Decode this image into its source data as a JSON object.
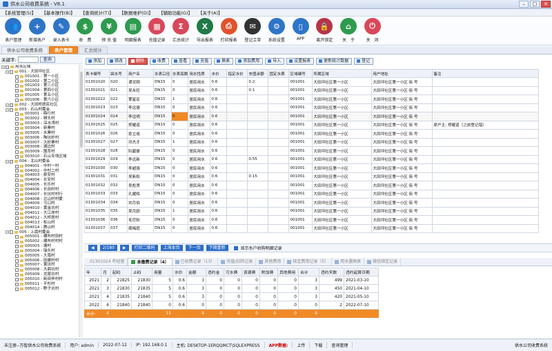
{
  "window": {
    "title": "供水公司收费系统 - V8.1"
  },
  "menu": [
    "【系统管理(S)】",
    "【基本操作(B)】",
    "【查询统计(T)】",
    "【数据维护(D)】",
    "【辅助功能(G)】",
    "【关于(A)】"
  ],
  "toolbar": [
    {
      "label": "表户管理",
      "icon": "users-icon",
      "color": "#2e75c9"
    },
    {
      "label": "新增表户",
      "icon": "add-user-icon",
      "color": "#2e75c9"
    },
    {
      "label": "录入表卡",
      "icon": "card-entry-icon",
      "color": "#2e75c9"
    },
    {
      "label": "收　费",
      "icon": "dollar-icon",
      "color": "#2e9b4e"
    },
    {
      "label": "预 充 值",
      "icon": "money-bag-icon",
      "color": "#2e9b4e"
    },
    {
      "label": "明细报表",
      "icon": "report-icon",
      "color": "#2e9b4e"
    },
    {
      "label": "充值记录",
      "icon": "record-icon",
      "color": "#d9475a"
    },
    {
      "label": "汇总统计",
      "icon": "summary-icon",
      "color": "#d9475a"
    },
    {
      "label": "导出报表",
      "icon": "excel-icon",
      "color": "#1f7a45"
    },
    {
      "label": "打印报表",
      "icon": "printer-icon",
      "color": "#e0522c"
    },
    {
      "label": "登记工单",
      "icon": "ticket-icon",
      "color": "#333333"
    },
    {
      "label": "系统设置",
      "icon": "gear-icon",
      "color": "#2e75c9"
    },
    {
      "label": "APP",
      "icon": "phone-icon",
      "color": "#2e75c9"
    },
    {
      "label": "离开锁定",
      "icon": "lock-icon",
      "color": "#b7344a"
    },
    {
      "label": "关　于",
      "icon": "home-icon",
      "color": "#2e9b4e"
    },
    {
      "label": "关　闭",
      "icon": "power-icon",
      "color": "#d9475a"
    }
  ],
  "tabs": [
    "供水公司收费系统",
    "表户管理",
    "汇总统计"
  ],
  "search": {
    "label": "关键字:",
    "button": "查询"
  },
  "tree": [
    {
      "level": 0,
      "text": "用水区域"
    },
    {
      "level": 1,
      "text": "001 - 大田坪社区"
    },
    {
      "level": 2,
      "text": "001001 - 第一小区"
    },
    {
      "level": 2,
      "text": "001002 - 第二小区"
    },
    {
      "level": 2,
      "text": "001003 - 第三小区"
    },
    {
      "level": 2,
      "text": "001004 - 第四小区"
    },
    {
      "level": 2,
      "text": "001005 - 第五小区"
    },
    {
      "level": 2,
      "text": "001006 - 第六小区"
    },
    {
      "level": 1,
      "text": "002 - 大田桥居民社区"
    },
    {
      "level": 1,
      "text": "003 - 石山村委会"
    },
    {
      "level": 2,
      "text": "003001 - 鼎行村"
    },
    {
      "level": 2,
      "text": "003002 - 狮头村"
    },
    {
      "level": 2,
      "text": "003003 - 深水湾村"
    },
    {
      "level": 2,
      "text": "003004 - 新寨村"
    },
    {
      "level": 2,
      "text": "003005 - 水寨村"
    },
    {
      "level": 2,
      "text": "003006 - 陶坑岭村"
    },
    {
      "level": 2,
      "text": "003007 - 大岭寨村"
    },
    {
      "level": 2,
      "text": "003008 - 湖边村"
    },
    {
      "level": 2,
      "text": "003009 - 围背村"
    },
    {
      "level": 2,
      "text": "003010 - 石山专场区域"
    },
    {
      "level": 1,
      "text": "004 - 北山村委会"
    },
    {
      "level": 2,
      "text": "004001 - 中村一村"
    },
    {
      "level": 2,
      "text": "004002 - 中村二村"
    },
    {
      "level": 2,
      "text": "004003 - 箭安村"
    },
    {
      "level": 2,
      "text": "004004 - 长安村"
    },
    {
      "level": 2,
      "text": "004005 - 长乐村"
    },
    {
      "level": 2,
      "text": "004006 - 长田村村"
    },
    {
      "level": 2,
      "text": "004007 - 长坑村村行"
    },
    {
      "level": 2,
      "text": "004008 - 北山村村委"
    },
    {
      "level": 2,
      "text": "004009 - 马口村"
    },
    {
      "level": 2,
      "text": "004010 - 黄金坑村"
    },
    {
      "level": 2,
      "text": "004011 - 大江岸村"
    },
    {
      "level": 2,
      "text": "004012 - 大桥居村"
    },
    {
      "level": 2,
      "text": "004013 - 松山村"
    },
    {
      "level": 2,
      "text": "004014 - 鹿山村"
    },
    {
      "level": 1,
      "text": "005 - 上南村委会"
    },
    {
      "level": 2,
      "text": "005001 - 横布村田村"
    },
    {
      "level": 2,
      "text": "005002 - 横布村村村"
    },
    {
      "level": 2,
      "text": "005003 - 塘村"
    },
    {
      "level": 2,
      "text": "005004 - 瑞头村"
    },
    {
      "level": 2,
      "text": "005005 - 大南村"
    },
    {
      "level": 2,
      "text": "005006 - 田建村村"
    },
    {
      "level": 2,
      "text": "005007 - 黄坑村"
    },
    {
      "level": 2,
      "text": "005008 - 大鼎坑村"
    },
    {
      "level": 2,
      "text": "005009 - 龙尾坑村"
    },
    {
      "level": 2,
      "text": "005010 - 新田甲村村"
    },
    {
      "level": 2,
      "text": "005011 - 平杉村"
    },
    {
      "level": 2,
      "text": "005012 - 野子坑村"
    }
  ],
  "actions": [
    "添加",
    "修改",
    "删除",
    "收费",
    "查看",
    "充值",
    "换表",
    "添加费用",
    "导入",
    "设置报表",
    "更新统计数据",
    "登记"
  ],
  "meters": {
    "columns": [
      "表卡编号",
      "袋水号",
      "用户名",
      "水表口径",
      "水表底数",
      "用水性质",
      "水价",
      "指定水价",
      "充值余额",
      "固定水费",
      "区域编号",
      "所属区域",
      "用户地址",
      "备注"
    ],
    "rows": [
      [
        "01301020",
        "020",
        "谭灵刚",
        "DN15",
        "0",
        "居民用水",
        "0.6",
        "",
        "0.2",
        "",
        "001001",
        "大田坪社区第一小区",
        "大田坪社区第一小区 街 号",
        ""
      ],
      [
        "01301021",
        "021",
        "吴永旺",
        "DN15",
        "0",
        "居民用水",
        "0.6",
        "",
        "0.1",
        "",
        "001001",
        "大田坪社区第一小区",
        "大田坪社区第一小区 街 号",
        ""
      ],
      [
        "01301022",
        "022",
        "覃星宏",
        "DN15",
        "1",
        "居民用水",
        "0.6",
        "",
        "",
        "",
        "001001",
        "大田坪社区第一小区",
        "大田坪社区第一小区 街 号",
        ""
      ],
      [
        "01301023",
        "023",
        "李远德",
        "DN15",
        "0",
        "居民用水",
        "0.6",
        "",
        "",
        "",
        "001001",
        "大田坪社区第一小区",
        "大田坪社区第一小区 街 号",
        ""
      ],
      [
        "01301024",
        "024",
        "李远明",
        "DN15",
        "0",
        "居民用水",
        "0.6",
        "",
        "",
        "",
        "001001",
        "大田坪社区第一小区",
        "大田坪社区第一小区 街 号",
        ""
      ],
      [
        "01301025",
        "025",
        "郑耀道",
        "DN15",
        "0",
        "居民用水",
        "0.6",
        "",
        "",
        "",
        "001001",
        "大田坪社区第一小区",
        "大田坪社区第一小区 街 号",
        "原户主: 郑耀道（之前登记错）"
      ],
      [
        "01301026",
        "026",
        "俞立成",
        "DN15",
        "0",
        "居民用水",
        "0.6",
        "",
        "",
        "",
        "001001",
        "大田坪社区第一小区",
        "大田坪社区第一小区 街 号",
        ""
      ],
      [
        "01301027",
        "027",
        "邓杰才",
        "DN15",
        "1",
        "居民用水",
        "0.6",
        "",
        "",
        "",
        "001001",
        "大田坪社区第一小区",
        "大田坪社区第一小区 街 号",
        ""
      ],
      [
        "01301028",
        "028",
        "阮碧晏",
        "DN15",
        "0",
        "居民用水",
        "0.6",
        "",
        "",
        "",
        "001001",
        "大田坪社区第一小区",
        "大田坪社区第一小区 街 号",
        ""
      ],
      [
        "01301029",
        "029",
        "李远新",
        "DN15",
        "0",
        "居民用水",
        "0.6",
        "",
        "0.55",
        "",
        "001001",
        "大田坪社区第一小区",
        "大田坪社区第一小区 街 号",
        ""
      ],
      [
        "01301030",
        "030",
        "李超强",
        "DN15",
        "0",
        "居民用水",
        "0.6",
        "",
        "",
        "",
        "001001",
        "大田坪社区第一小区",
        "大田坪社区第一小区 街 号",
        ""
      ],
      [
        "01301031",
        "031",
        "吴新和",
        "DN15",
        "0",
        "居民用水",
        "0.6",
        "",
        "0.15",
        "",
        "001001",
        "大田坪社区第一小区",
        "大田坪社区第一小区 街 号",
        ""
      ],
      [
        "01301032",
        "032",
        "吴彪贤",
        "DN15",
        "0",
        "居民用水",
        "0.6",
        "",
        "",
        "",
        "001001",
        "大田坪社区第一小区",
        "大田坪社区第一小区 街 号",
        ""
      ],
      [
        "01301033",
        "033",
        "孔耀辉",
        "DN15",
        "0",
        "居民用水",
        "0.6",
        "",
        "",
        "",
        "001001",
        "大田坪社区第一小区",
        "大田坪社区第一小区 街 号",
        ""
      ],
      [
        "01301034",
        "034",
        "刘月伯",
        "DN15",
        "0",
        "居民用水",
        "0.6",
        "",
        "",
        "",
        "001001",
        "大田坪社区第一小区",
        "大田坪社区第一小区 街 号",
        ""
      ],
      [
        "01301035",
        "035",
        "吴月欧",
        "DN15",
        "1",
        "居民用水",
        "0.6",
        "",
        "",
        "",
        "001001",
        "大田坪社区第一小区",
        "大田坪社区第一小区 街 号",
        ""
      ],
      [
        "01301036",
        "036",
        "毛尽秋",
        "DN15",
        "0",
        "居民用水",
        "0.6",
        "",
        "",
        "",
        "001001",
        "大田坪社区第一小区",
        "大田坪社区第一小区 街 号",
        ""
      ],
      [
        "01301037",
        "037",
        "周梅庭",
        "DN15",
        "0",
        "居民用水",
        "0.6",
        "",
        "",
        "",
        "001001",
        "大田坪社区第一小区",
        "大田坪社区第一小区 街 号",
        ""
      ]
    ]
  },
  "pager": {
    "first": "◀",
    "page": "2/180",
    "last": "▶",
    "print": "打印二维码",
    "up": "上海本页",
    "down": "下一页",
    "next": "下期重新",
    "chk": "显示水户收购明细记录"
  },
  "subtabs": [
    "01301024 年经营",
    "本缴费记录（4）",
    "已收费记录（13）",
    "充值/扣除记录",
    "其他费用",
    "核定费用记录（5）",
    "用水量图表",
    "微信绑定记录"
  ],
  "charges": {
    "columns": [
      "年",
      "月",
      "起码",
      "止码",
      "用量",
      "水价",
      "金额",
      "违约金",
      "污水费",
      "资源费",
      "附加费",
      "其他费用",
      "合计",
      "违约天数",
      "违约起算日期"
    ],
    "rows": [
      [
        "2021",
        "2",
        "21825",
        "21830",
        "5",
        "0.6",
        "3",
        "0",
        "0",
        "0",
        "0",
        "0",
        "3",
        "499",
        "2021-03-10"
      ],
      [
        "2021",
        "3",
        "21830",
        "21835",
        "5",
        "0.6",
        "3",
        "0",
        "0",
        "0",
        "0",
        "0",
        "3",
        "450",
        "2021-04-10"
      ],
      [
        "2021",
        "4",
        "21835",
        "21840",
        "5",
        "0.6",
        "3",
        "0",
        "0",
        "0",
        "0",
        "0",
        "3",
        "420",
        "2021-05-10"
      ],
      [
        "2022",
        "6",
        "21840",
        "21840",
        "0",
        "0.6",
        "0",
        "0",
        "0",
        "0",
        "0",
        "0",
        "0",
        "2",
        "2022-07-10"
      ]
    ],
    "total": [
      "合计:",
      "4",
      "",
      "",
      "15",
      "",
      "9",
      "0",
      "0",
      "0",
      "0",
      "0",
      "9",
      "",
      ""
    ]
  },
  "status": {
    "reg": "未注册--万智供水公司收费系统",
    "user_label": "用户:",
    "user": "admin",
    "date": "2022-07-12",
    "ip_label": "IP:",
    "ip": "192.168.0.1",
    "host_label": "主机:",
    "host": "DESKTOP-1ERQQMCT\\SQLEXPRESS",
    "app": "APP数据:",
    "upload": "上传",
    "download": "下载",
    "query": "查询管理",
    "sys": "供水公司收费系统"
  }
}
